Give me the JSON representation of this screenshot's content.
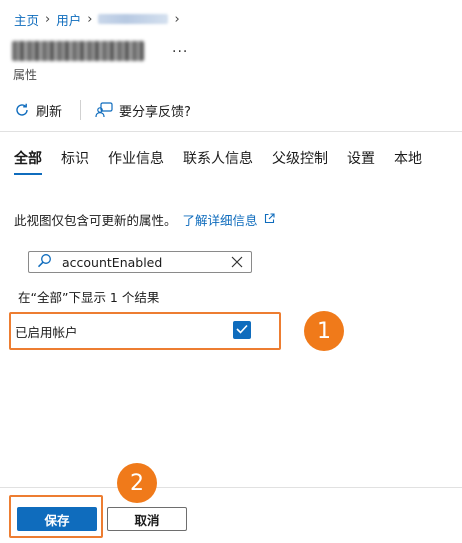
{
  "breadcrumb": {
    "items": [
      "主页",
      "用户"
    ]
  },
  "page": {
    "more_label": "...",
    "subtitle": "属性"
  },
  "commands": {
    "refresh": "刷新",
    "feedback": "要分享反馈?"
  },
  "tabs": [
    "全部",
    "标识",
    "作业信息",
    "联系人信息",
    "父级控制",
    "设置",
    "本地"
  ],
  "info": {
    "text": "此视图仅包含可更新的属性。",
    "link": "了解详细信息"
  },
  "search": {
    "value": "accountEnabled"
  },
  "result_text": "在“全部”下显示 1 个结果",
  "field": {
    "label": "已启用帐户",
    "checked": true
  },
  "badges": [
    "1",
    "2"
  ],
  "footer": {
    "save": "保存",
    "cancel": "取消"
  },
  "colors": {
    "accent": "#0f6cbd",
    "highlight": "#ed7d31",
    "badge": "#f07a1a"
  }
}
